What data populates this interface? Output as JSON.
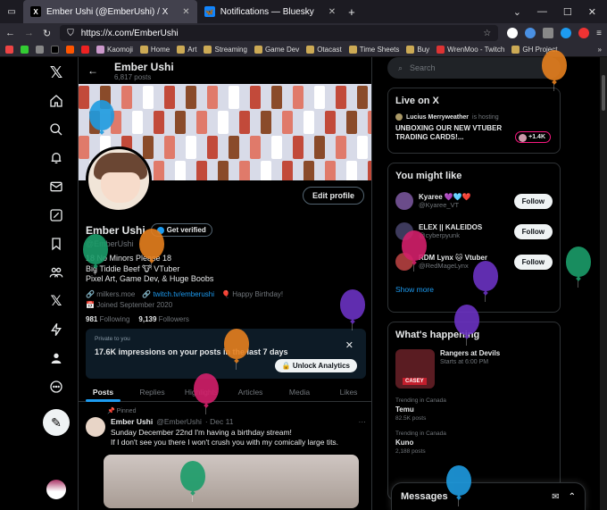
{
  "browser": {
    "tabs": [
      {
        "title": "Ember Ushi (@EmberUshi) / X",
        "active": true,
        "favicon": "X"
      },
      {
        "title": "Notifications — Bluesky",
        "active": false,
        "favicon": "butterfly"
      }
    ],
    "new_tab": "+",
    "url": "https://x.com/EmberUshi",
    "bookmarks": [
      "Kaomoji",
      "Home",
      "Art",
      "Streaming",
      "Game Dev",
      "Otacast",
      "Time Sheets",
      "Buy",
      "WrenMoo - Twitch",
      "GH Project"
    ],
    "bookmarks_overflow": "»"
  },
  "nav": {
    "icons": [
      "x-logo-icon",
      "home-icon",
      "search-icon",
      "notifications-icon",
      "messages-icon",
      "grok-icon",
      "bookmarks-icon",
      "communities-icon",
      "premium-icon",
      "verified-orgs-icon",
      "profile-icon",
      "more-icon"
    ]
  },
  "profile": {
    "header_name": "Ember Ushi",
    "post_count": "6,817 posts",
    "edit_label": "Edit profile",
    "name": "Ember Ushi",
    "verify_label": "Get verified",
    "handle": "@EmberUshi",
    "bio_line1": "18 No Minors Please 18",
    "bio_line2": "Big Tiddie Beef 🐮 VTuber",
    "bio_line3": "Pixel Art, Game Dev, & Huge Boobs",
    "website": "milkers.moe",
    "twitch": "twitch.tv/emberushi",
    "birthday": "Happy Birthday!",
    "joined": "Joined September 2020",
    "following_count": "981",
    "following_label": "Following",
    "followers_count": "9,139",
    "followers_label": "Followers"
  },
  "analytics": {
    "small": "Private to you",
    "title": "17.6K impressions on your posts in the last 7 days",
    "button": "Unlock Analytics",
    "close": "✕"
  },
  "tabs": [
    "Posts",
    "Replies",
    "Highlights",
    "Articles",
    "Media",
    "Likes"
  ],
  "pinned": {
    "label": "Pinned",
    "name": "Ember Ushi",
    "handle": "@EmberUshi",
    "date": "· Dec 11",
    "line1": "Sunday December 22nd I'm having a birthday stream!",
    "line2": "If I don't see you there I won't crush you with my comically large tits."
  },
  "right": {
    "search_placeholder": "Search",
    "live_title": "Live on X",
    "live_host": "Lucius Merryweather",
    "live_hosting": "is hosting",
    "live_text": "UNBOXING OUR NEW VTUBER TRADING CARDS!...",
    "live_count": "+1.4K",
    "wtf_title": "You might like",
    "suggestions": [
      {
        "name": "Kyaree 💜🩵❤️",
        "handle": "@Kyaree_VT",
        "button": "Follow",
        "color": "#6b4c8a"
      },
      {
        "name": "ELEX || KALEIDOS",
        "handle": "@cyberpyunk",
        "button": "Follow",
        "color": "#3d3a5c"
      },
      {
        "name": "RDM Lynx 🐱 Vtuber",
        "handle": "@RedMageLynx",
        "button": "Follow",
        "color": "#a33a3a"
      }
    ],
    "show_more": "Show more",
    "happening_title": "What's happening",
    "event_title": "Rangers at Devils",
    "event_time": "Starts at 6:00 PM",
    "event_tag": "CASEY",
    "trends": [
      {
        "category": "Trending in Canada",
        "name": "Temu",
        "count": "82.5K posts"
      },
      {
        "category": "Trending in Canada",
        "name": "Kuno",
        "count": "2,188 posts"
      }
    ],
    "messages_label": "Messages"
  },
  "colors": {
    "accent": "#1d9bf0",
    "balloons": [
      "#e6801f",
      "#1e9be0",
      "#1b9d6a",
      "#e6801f",
      "#6b32c2",
      "#d3206b",
      "#6b32c2",
      "#1b9d6a",
      "#e6801f",
      "#d3206b",
      "#1b9d6a",
      "#1e9be0",
      "#6b32c2"
    ]
  }
}
